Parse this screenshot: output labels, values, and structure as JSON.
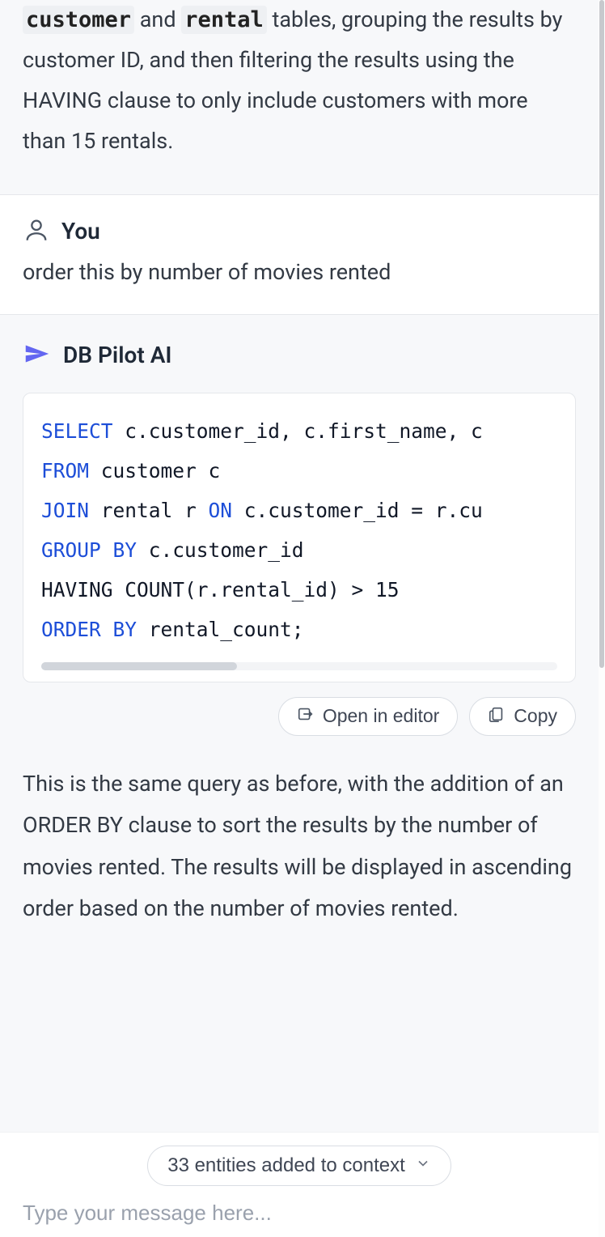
{
  "prev_ai": {
    "code_token_1": "customer",
    "code_token_2": "rental",
    "text_before": "`",
    "text_mid1": "` and `",
    "text_mid2": "` tables, grouping the results by customer ID, and then filtering the results using the HAVING clause to only include customers with more than 15 rentals."
  },
  "user_msg": {
    "sender": "You",
    "content": "order this by number of movies rented"
  },
  "ai_msg": {
    "sender": "DB Pilot AI",
    "code": {
      "l1_kw": "SELECT",
      "l1_rest": " c.customer_id, c.first_name, c",
      "l2_kw": "FROM",
      "l2_rest": " customer c",
      "l3_kw1": "JOIN",
      "l3_mid": " rental r ",
      "l3_kw2": "ON",
      "l3_rest": " c.customer_id = r.cu",
      "l4_kw": "GROUP BY",
      "l4_rest": " c.customer_id",
      "l5": "HAVING COUNT(r.rental_id) > 15",
      "l6_kw": "ORDER BY",
      "l6_rest": " rental_count;"
    },
    "open_btn": "Open in editor",
    "copy_btn": "Copy",
    "explanation": "This is the same query as before, with the addition of an ORDER BY clause to sort the results by the number of movies rented. The results will be displayed in ascending order based on the number of movies rented."
  },
  "context_pill": "33 entities added to context",
  "input_placeholder": "Type your message here..."
}
